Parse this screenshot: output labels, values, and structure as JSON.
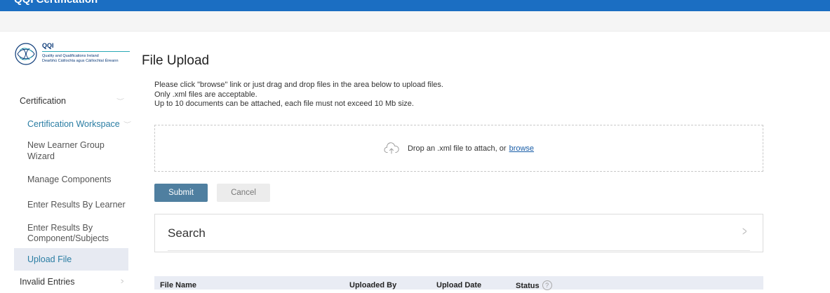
{
  "app": {
    "title": "QQI Certification"
  },
  "logo": {
    "brand": "QQI",
    "line1": "Quality and Qualifications Ireland",
    "line2": "Dearbhú Cáilíochta agus Cáilíochtaí Éireann"
  },
  "sidebar": {
    "items": [
      {
        "label": "Certification"
      },
      {
        "label": "Certification Workspace"
      },
      {
        "label": "New Learner Group Wizard"
      },
      {
        "label": "Manage Components"
      },
      {
        "label": "Enter Results By Learner"
      },
      {
        "label": "Enter Results By Component/Subjects"
      },
      {
        "label": "Upload File"
      },
      {
        "label": "Invalid Entries"
      }
    ]
  },
  "page": {
    "title": "File Upload",
    "instructions": [
      "Please click \"browse\" link or just drag and drop files in the area below to upload files.",
      "Only .xml files are acceptable.",
      "Up to 10 documents can be attached, each file must not exceed 10 Mb size."
    ]
  },
  "dropzone": {
    "text": "Drop an .xml file to attach, or",
    "link": "browse",
    "icon": "cloud-upload-icon"
  },
  "buttons": {
    "submit": "Submit",
    "cancel": "Cancel"
  },
  "search": {
    "label": "Search"
  },
  "table": {
    "columns": [
      "File Name",
      "Uploaded By",
      "Upload Date",
      "Status"
    ]
  },
  "colors": {
    "topbar": "#1b6ec2",
    "accent": "#2a7da3",
    "submit": "#4f7fa0",
    "active_nav": "#e7eaf2",
    "table_header": "#e9ecf4"
  }
}
